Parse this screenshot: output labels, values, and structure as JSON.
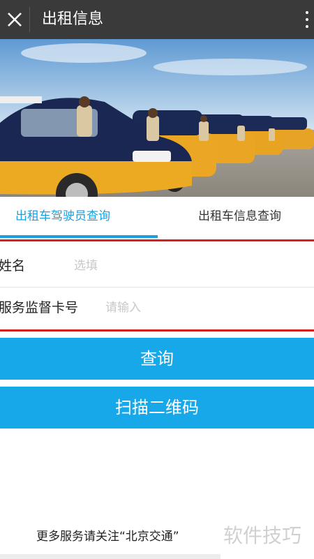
{
  "header": {
    "title": "出租信息"
  },
  "tabs": [
    {
      "label": "出租车驾驶员查询",
      "active": true
    },
    {
      "label": "出租车信息查询",
      "active": false
    }
  ],
  "form": {
    "name_label": "姓名",
    "name_placeholder": "选填",
    "card_label": "服务监督卡号",
    "card_placeholder": "请输入"
  },
  "buttons": {
    "query": "查询",
    "scan": "扫描二维码"
  },
  "footer": {
    "text": "更多服务请关注“北京交通”",
    "watermark": "软件技巧"
  },
  "colors": {
    "accent": "#1aa0e0",
    "button": "#16a8e8",
    "highlight_line": "#d62020",
    "topbar": "#3a3a3a"
  }
}
